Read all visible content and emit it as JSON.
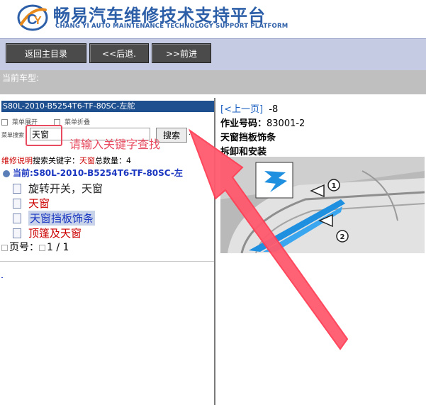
{
  "header": {
    "title_cn": "畅易汽车维修技术支持平台",
    "title_en": "CHANG YI AUTO MAINTENANCE TECHNOLOGY SUPPORT PLATFORM"
  },
  "toolbar": {
    "home_label": "返回主目录",
    "back_label": "<<后退.",
    "forward_label": ">>前进"
  },
  "vehicle": {
    "label": "当前车型:"
  },
  "left": {
    "model": "S80L-2010-B5254T6-TF-80SC-左舵",
    "expand_label": "菜单展开",
    "collapse_label": "菜单折叠",
    "search_label": "菜单搜索",
    "search_value": "天窗",
    "search_button": "搜索",
    "search_dots": "..",
    "hint": "请输入关键字查找",
    "info_prefix": "维修说明",
    "info_keyword_label": "搜索关键字：",
    "info_keyword": "天窗",
    "info_count_label": "总数量：",
    "info_count": "4",
    "current": "当前:S80L-2010-B5254T6-TF-80SC-左",
    "items": [
      {
        "label": "旋转开关，天窗"
      },
      {
        "label": "天窗"
      },
      {
        "label": "天窗挡板饰条"
      },
      {
        "label": "顶篷及天窗"
      }
    ],
    "page_label": "页号：",
    "page_value": "1 / 1"
  },
  "right": {
    "prev_page": "[<上一页]",
    "prev_suffix": "-8",
    "op_label": "作业号码：",
    "op_number": "83001-2",
    "part_title": "天窗挡板饰条",
    "part_sub": "拆卸和安装",
    "callout_1": "1",
    "callout_2": "2"
  },
  "colors": {
    "brand_blue": "#2d5fa8",
    "toolbar_bg": "#c6cbe4",
    "button_bg": "#4b4b4b",
    "model_bar": "#1e4f8f",
    "annotation_red": "#e84a5f",
    "part_blue": "#1f8fe0"
  }
}
